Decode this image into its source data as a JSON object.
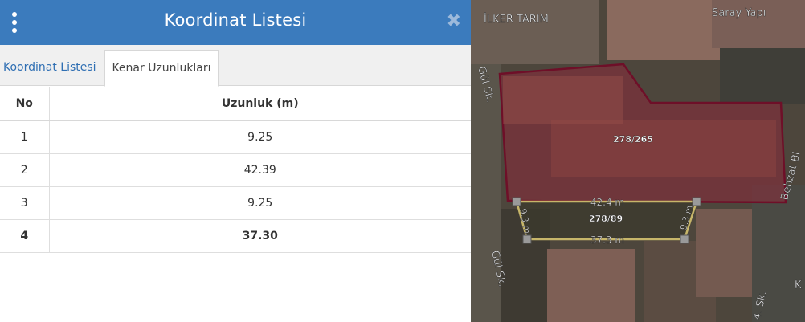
{
  "panel": {
    "title": "Koordinat Listesi",
    "close_symbol": "✖",
    "tabs": [
      {
        "label": "Koordinat Listesi",
        "active": false
      },
      {
        "label": "Kenar Uzunlukları",
        "active": true
      }
    ]
  },
  "table": {
    "headers": {
      "no": "No",
      "length": "Uzunluk (m)"
    },
    "rows": [
      {
        "no": "1",
        "length": "9.25"
      },
      {
        "no": "2",
        "length": "42.39"
      },
      {
        "no": "3",
        "length": "9.25"
      },
      {
        "no": "4",
        "length": "37.30"
      }
    ]
  },
  "map": {
    "labels": {
      "shop_left": "İLKER TARIM",
      "shop_right": "Saray Yapı",
      "street_gul_top": "Gül Sk.",
      "street_gul_bottom": "Gül Sk.",
      "street_behzat": "Behzat Bl",
      "street_4": "4. Sk.",
      "street_k": "K"
    },
    "parcel_main_label": "278/265",
    "parcel_selected_label": "278/89",
    "edge_labels": {
      "top": "42.4 m",
      "bottom": "37.3 m",
      "left": "9.3 m",
      "right": "9.3 m"
    },
    "colors": {
      "parcel_outline": "#6e0f28",
      "selection_outline": "#c7b66a",
      "header_blue": "#3b7bbd"
    }
  }
}
